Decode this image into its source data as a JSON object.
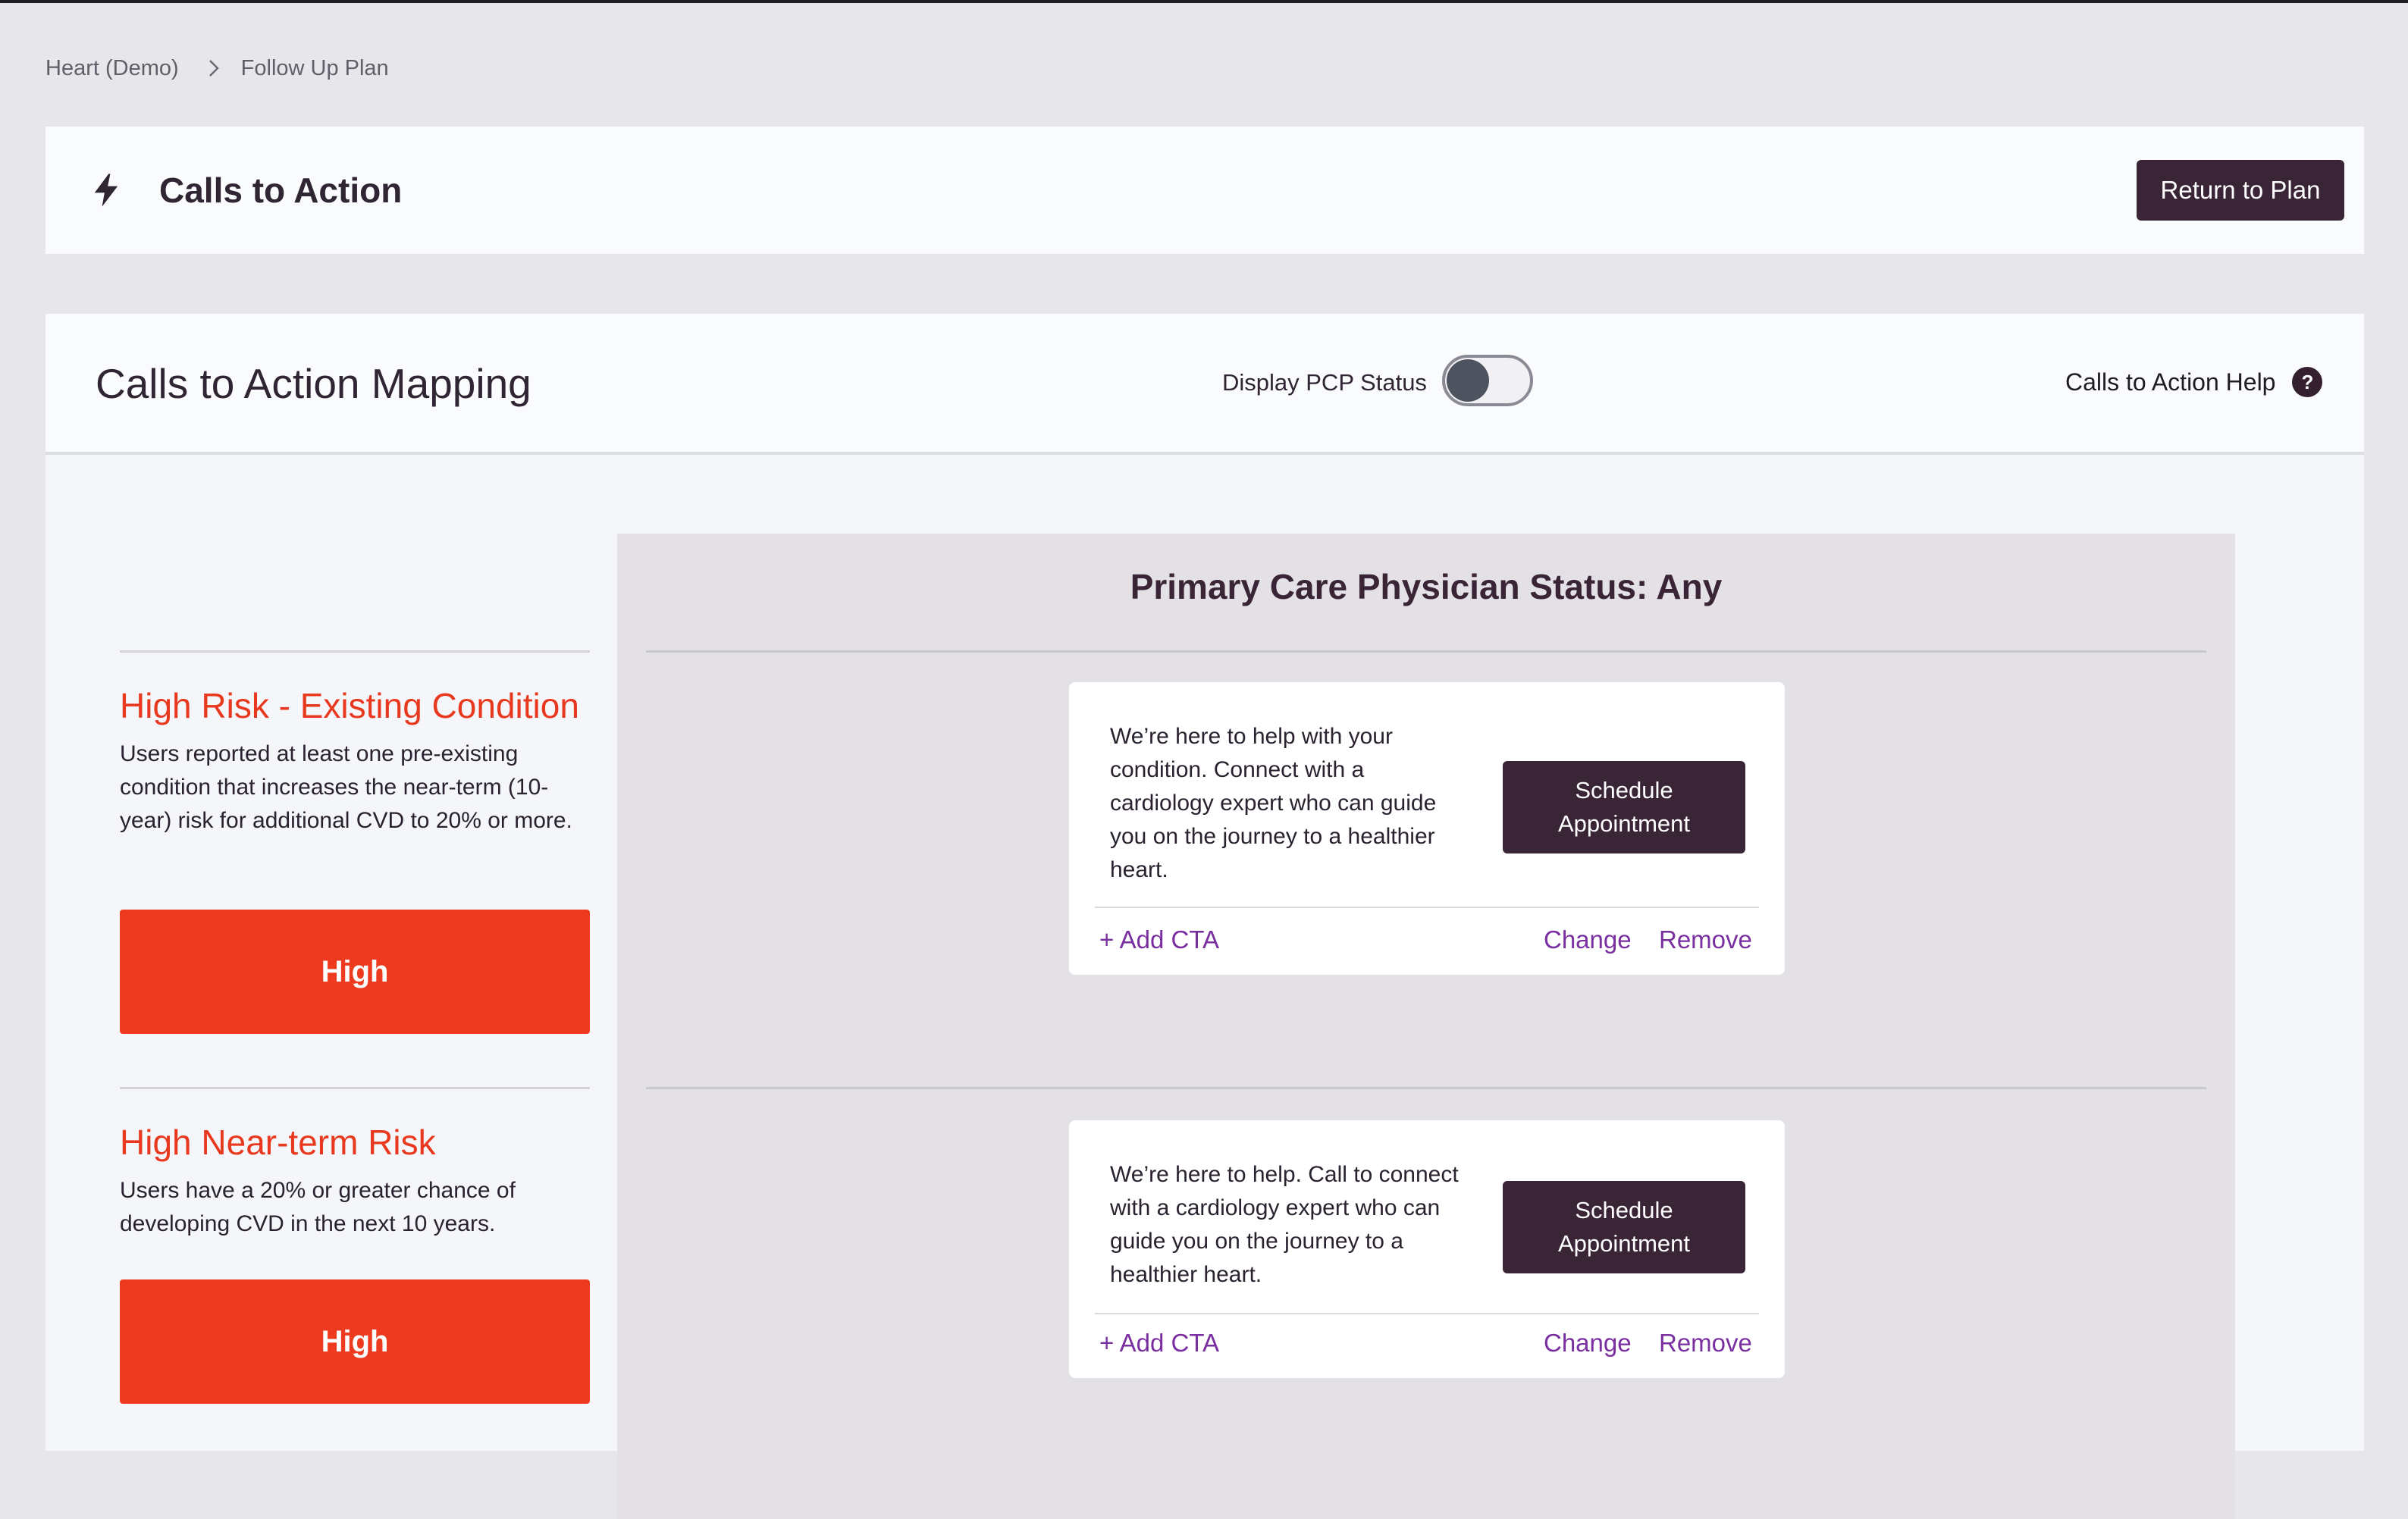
{
  "breadcrumb": {
    "items": [
      "Heart (Demo)",
      "Follow Up Plan"
    ]
  },
  "header": {
    "icon": "bolt-icon",
    "title": "Calls to Action",
    "return_button": "Return to Plan"
  },
  "mapping": {
    "title": "Calls to Action Mapping",
    "pcp_toggle_label": "Display PCP Status",
    "pcp_toggle_on": false,
    "help_label": "Calls to Action Help",
    "help_icon": "question-icon"
  },
  "risks": [
    {
      "title": "High Risk - Existing Condition",
      "description": "Users reported at least one pre-existing condition that increases the near-term (10-year) risk for additional CVD to 20% or more.",
      "badge": "High"
    },
    {
      "title": "High Near-term Risk",
      "description": "Users have a 20% or greater chance of developing CVD in the next 10 years.",
      "badge": "High"
    }
  ],
  "pcp_panel": {
    "title": "Primary Care Physician Status: Any",
    "ctas": [
      {
        "text": "We’re here to help with your condition. Connect with a cardiology expert who can guide you on the journey to a healthier heart.",
        "button": "Schedule\nAppointment",
        "add_label": "+ Add CTA",
        "change_label": "Change",
        "remove_label": "Remove"
      },
      {
        "text": "We’re here to help. Call to connect with a cardiology expert who can guide you on the journey to a healthier heart.",
        "button": "Schedule\nAppointment",
        "add_label": "+ Add CTA",
        "change_label": "Change",
        "remove_label": "Remove"
      }
    ]
  },
  "colors": {
    "brand_dark": "#3a2536",
    "risk_red": "#ee3a1f",
    "link_purple": "#7a2fa0"
  }
}
